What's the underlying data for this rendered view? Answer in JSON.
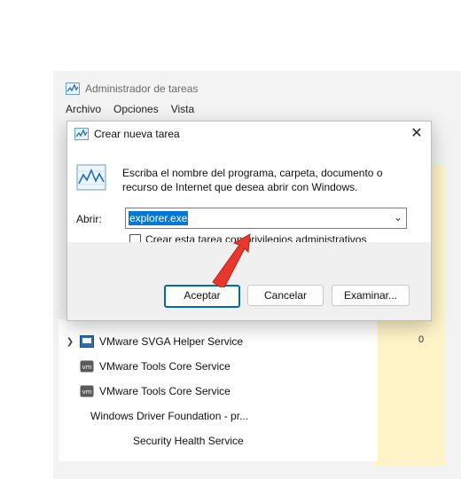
{
  "task_manager": {
    "title": "Administrador de tareas",
    "menu": [
      "Archivo",
      "Opciones",
      "Vista"
    ],
    "processes": [
      {
        "name": "VMware SVGA Helper Service",
        "has_chevron": true
      },
      {
        "name": "VMware Tools Core Service",
        "has_chevron": false
      },
      {
        "name": "VMware Tools Core Service",
        "has_chevron": false
      },
      {
        "name": "Windows Driver Foundation - pr...",
        "has_chevron": false
      },
      {
        "name": "Security Health Service",
        "has_chevron": false
      }
    ],
    "column_value_cell": "0"
  },
  "dialog": {
    "title": "Crear nueva tarea",
    "description": "Escriba el nombre del programa, carpeta, documento o recurso de Internet que desea abrir con Windows.",
    "open_label": "Abrir:",
    "input_value": "explorer.exe",
    "checkbox_label": "Crear esta tarea con privilegios administrativos",
    "buttons": {
      "ok": "Aceptar",
      "cancel": "Cancelar",
      "browse": "Examinar..."
    },
    "close_glyph": "✕"
  },
  "colors": {
    "accent": "#0078d4",
    "arrow": "#e8372c",
    "highlight_column": "#fff4c8"
  }
}
